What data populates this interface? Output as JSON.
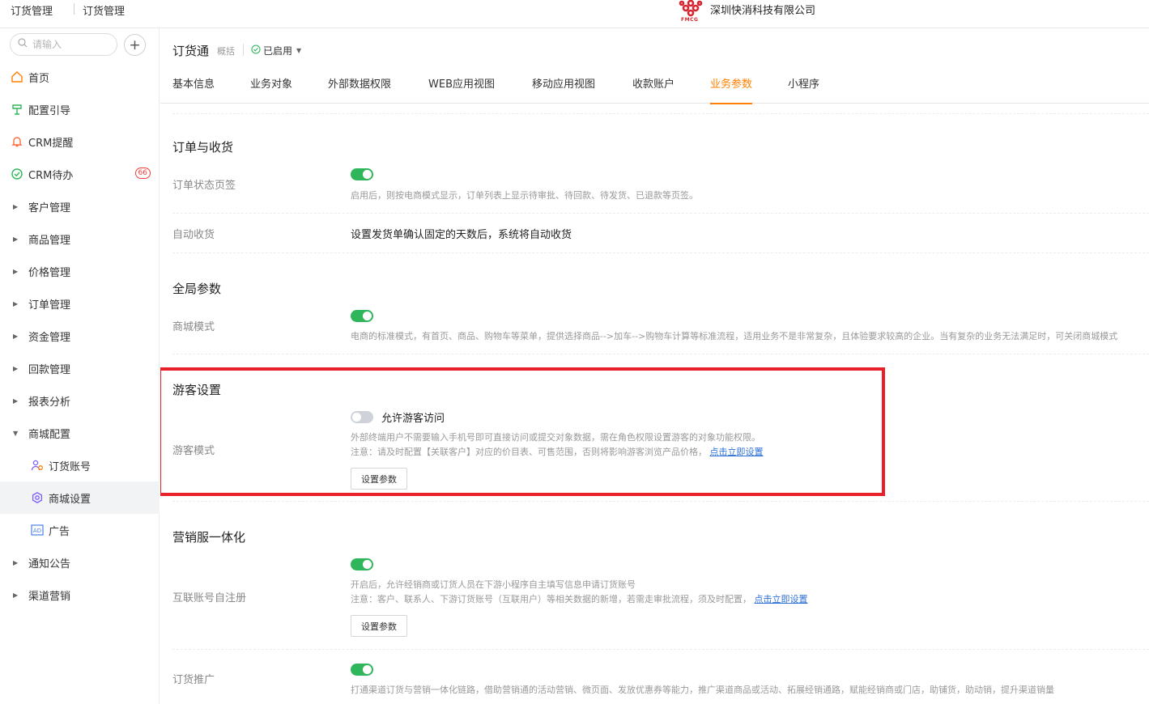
{
  "topbar": {
    "crumb1": "订货管理",
    "crumb2": "订货管理",
    "company": "深圳快消科技有限公司",
    "logo_text": "FMCG"
  },
  "sidebar": {
    "search_placeholder": "请输入",
    "add_symbol": "+",
    "items": [
      {
        "label": "首页",
        "icon": "home-icon"
      },
      {
        "label": "配置引导",
        "icon": "guide-icon"
      },
      {
        "label": "CRM提醒",
        "icon": "bell-icon"
      },
      {
        "label": "CRM待办",
        "icon": "check-circle-icon",
        "badge": "66"
      },
      {
        "label": "客户管理"
      },
      {
        "label": "商品管理"
      },
      {
        "label": "价格管理"
      },
      {
        "label": "订单管理"
      },
      {
        "label": "资金管理"
      },
      {
        "label": "回款管理"
      },
      {
        "label": "报表分析"
      },
      {
        "label": "商城配置",
        "expanded": true
      },
      {
        "label": "订货账号",
        "icon": "users-icon"
      },
      {
        "label": "商城设置",
        "icon": "settings-icon",
        "active": true
      },
      {
        "label": "广告",
        "icon": "ad-icon"
      },
      {
        "label": "通知公告"
      },
      {
        "label": "渠道营销"
      }
    ]
  },
  "header": {
    "title": "订货通",
    "subtitle": "概括",
    "status": "已启用",
    "tabs": [
      "基本信息",
      "业务对象",
      "外部数据权限",
      "WEB应用视图",
      "移动应用视图",
      "收款账户",
      "业务参数",
      "小程序"
    ],
    "active_tab": "业务参数"
  },
  "sections": {
    "order": {
      "title": "订单与收货",
      "status_tab_label": "订单状态页签",
      "status_tab_toggle": "on",
      "status_tab_desc": "启用后，则按电商模式显示，订单列表上显示待审批、待回款、待发货、已退款等页签。",
      "auto_receive_label": "自动收货",
      "auto_receive_text": "设置发货单确认固定的天数后，系统将自动收货"
    },
    "global": {
      "title": "全局参数",
      "mall_mode_label": "商城模式",
      "mall_mode_toggle": "on",
      "mall_mode_desc": "电商的标准模式，有首页、商品、购物车等菜单，提供选择商品-->加车-->购物车计算等标准流程，适用业务不是非常复杂，且体验要求较高的企业。当有复杂的业务无法满足时，可关闭商城模式"
    },
    "guest": {
      "title": "游客设置",
      "mode_label": "游客模式",
      "toggle": "off",
      "toggle_label": "允许游客访问",
      "desc1": "外部终端用户不需要输入手机号即可直接访问或提交对象数据，需在角色权限设置游客的对象功能权限。",
      "desc2": "注意：请及时配置【关联客户】对应的价目表、可售范围，否则将影响游客浏览产品价格，",
      "link": "点击立即设置",
      "button": "设置参数"
    },
    "marketing": {
      "title": "营销服一体化",
      "register_label": "互联账号自注册",
      "register_toggle": "on",
      "register_desc1": "开启后，允许经销商或订货人员在下游小程序自主填写信息申请订货账号",
      "register_desc2": "注意：客户、联系人、下游订货账号（互联用户）等相关数据的新增，若需走审批流程，须及时配置，",
      "register_link": "点击立即设置",
      "register_button": "设置参数",
      "promo_label": "订货推广",
      "promo_toggle": "on",
      "promo_desc": "打通渠道订货与营销一体化链路，借助营销通的活动营销、微页面、发放优惠券等能力，推广渠道商品或活动、拓展经销通路，赋能经销商或门店，助铺货，助动销，提升渠道销量"
    }
  },
  "colors": {
    "accent": "#ff8000",
    "toggle_on": "#30b65a",
    "link": "#2c70d8",
    "highlight": "#e8202a"
  }
}
